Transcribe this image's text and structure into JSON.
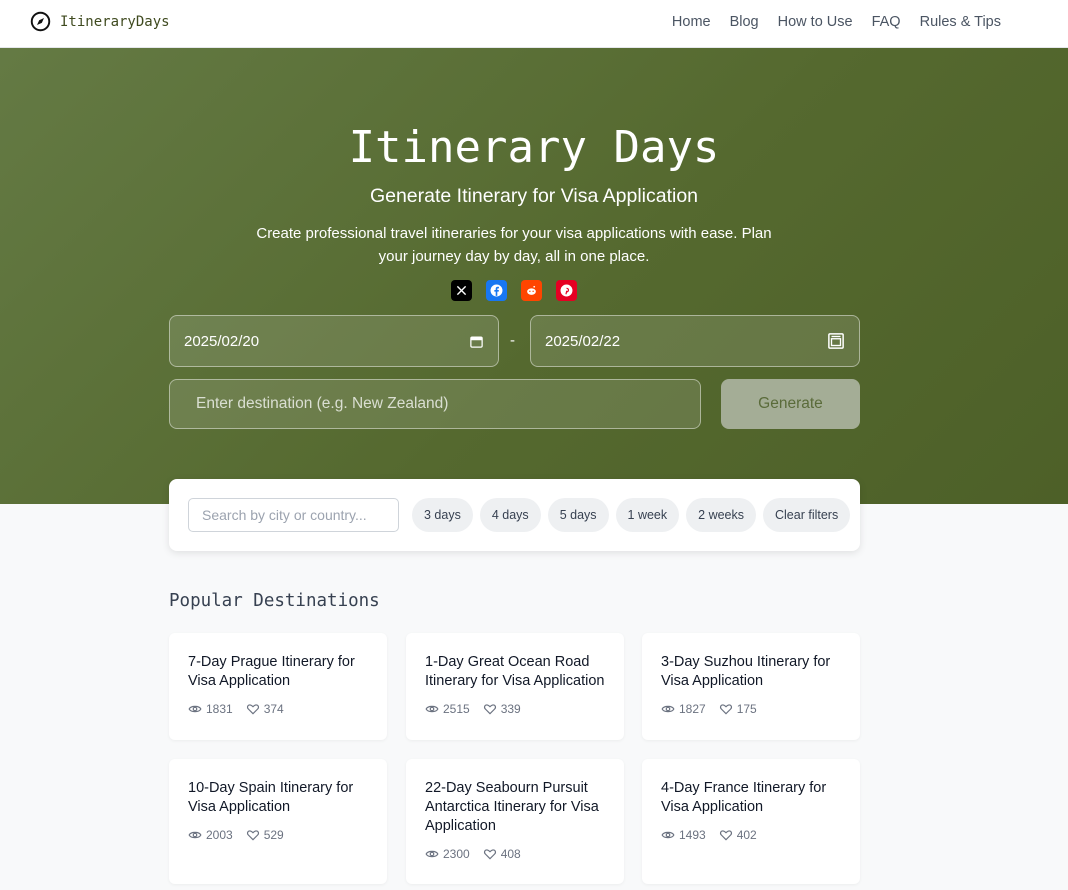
{
  "brand": {
    "name": "ItineraryDays"
  },
  "nav": {
    "links": [
      "Home",
      "Blog",
      "How to Use",
      "FAQ",
      "Rules & Tips"
    ]
  },
  "hero": {
    "title": "Itinerary Days",
    "subtitle": "Generate Itinerary for Visa Application",
    "description": "Create professional travel itineraries for your visa applications with ease. Plan your journey day by day, all in one place.",
    "social": [
      {
        "name": "x-icon",
        "glyph": "X",
        "color": "#000000"
      },
      {
        "name": "facebook-icon",
        "glyph": "f",
        "color": "#1877f2"
      },
      {
        "name": "reddit-icon",
        "glyph": "●",
        "color": "#ff4500"
      },
      {
        "name": "pinterest-icon",
        "glyph": "P",
        "color": "#e60023"
      }
    ],
    "start_date": "2025/02/20",
    "date_separator": "-",
    "end_date": "2025/02/22",
    "destination_placeholder": "Enter destination (e.g. New Zealand)",
    "generate_label": "Generate"
  },
  "filters": {
    "search_placeholder": "Search by city or country...",
    "chips": [
      "3 days",
      "4 days",
      "5 days",
      "1 week",
      "2 weeks",
      "Clear filters"
    ]
  },
  "popular": {
    "title": "Popular Destinations",
    "cards": [
      {
        "title": "7-Day Prague Itinerary for Visa Application",
        "views": "1831",
        "likes": "374"
      },
      {
        "title": "1-Day Great Ocean Road Itinerary for Visa Application",
        "views": "2515",
        "likes": "339"
      },
      {
        "title": "3-Day Suzhou Itinerary for Visa Application",
        "views": "1827",
        "likes": "175"
      },
      {
        "title": "10-Day Spain Itinerary for Visa Application",
        "views": "2003",
        "likes": "529"
      },
      {
        "title": "22-Day Seabourn Pursuit Antarctica Itinerary for Visa Application",
        "views": "2300",
        "likes": "408"
      },
      {
        "title": "4-Day France Itinerary for Visa Application",
        "views": "1493",
        "likes": "402"
      }
    ]
  },
  "colors": {
    "hero_green": "#5a6e37",
    "button": "#a4ad96"
  }
}
